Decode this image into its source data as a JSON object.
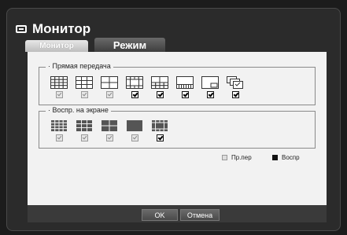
{
  "window": {
    "title": "Монитор",
    "icon": "monitor-icon"
  },
  "tabs": [
    {
      "label": "Монитор",
      "active": false
    },
    {
      "label": "Режим",
      "active": true
    }
  ],
  "live": {
    "label": "· Прямая передача",
    "items": [
      {
        "layout": "grid-16-icon",
        "check": "grey"
      },
      {
        "layout": "grid-9-icon",
        "check": "grey"
      },
      {
        "layout": "grid-4-icon",
        "check": "grey"
      },
      {
        "layout": "layout-13-icon",
        "check": "black"
      },
      {
        "layout": "layout-10-icon",
        "check": "black"
      },
      {
        "layout": "layout-8-icon",
        "check": "black"
      },
      {
        "layout": "pip-icon",
        "check": "black"
      },
      {
        "layout": "sequence-icon",
        "check": "black"
      }
    ]
  },
  "playback": {
    "label": "· Воспр. на экране",
    "items": [
      {
        "layout": "grid-16-icon",
        "check": "grey"
      },
      {
        "layout": "grid-9-icon",
        "check": "grey"
      },
      {
        "layout": "grid-4-icon",
        "check": "grey"
      },
      {
        "layout": "single-icon",
        "check": "grey"
      },
      {
        "layout": "layout-13-icon",
        "check": "black"
      }
    ]
  },
  "legend": {
    "preview": "Пр.пер",
    "play": "Воспр"
  },
  "buttons": {
    "ok": "OK",
    "cancel": "Отмена"
  }
}
